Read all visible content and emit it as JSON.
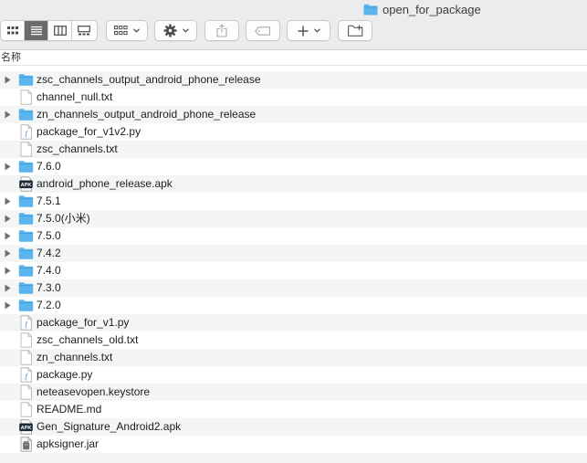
{
  "window": {
    "title": "open_for_package"
  },
  "toolbar": {
    "view_modes": [
      {
        "name": "icon-view",
        "active": false
      },
      {
        "name": "list-view",
        "active": true
      },
      {
        "name": "column-view",
        "active": false
      },
      {
        "name": "gallery-view",
        "active": false
      }
    ],
    "group_button_icon": "grid-group-icon",
    "action_button_icon": "gear-icon",
    "share_button_icon": "share-icon",
    "tag_button_icon": "tag-icon",
    "add_button_icon": "plus-icon",
    "new_folder_button_icon": "new-folder-icon"
  },
  "columns": {
    "name_header": "名称"
  },
  "files": [
    {
      "name": "zsc_channels_output_android_phone_release",
      "kind": "folder",
      "expandable": true
    },
    {
      "name": "channel_null.txt",
      "kind": "text",
      "expandable": false
    },
    {
      "name": "zn_channels_output_android_phone_release",
      "kind": "folder",
      "expandable": true
    },
    {
      "name": "package_for_v1v2.py",
      "kind": "python",
      "expandable": false
    },
    {
      "name": "zsc_channels.txt",
      "kind": "text",
      "expandable": false
    },
    {
      "name": "7.6.0",
      "kind": "folder",
      "expandable": true
    },
    {
      "name": "android_phone_release.apk",
      "kind": "apk",
      "expandable": false
    },
    {
      "name": "7.5.1",
      "kind": "folder",
      "expandable": true
    },
    {
      "name": "7.5.0(小米)",
      "kind": "folder",
      "expandable": true
    },
    {
      "name": "7.5.0",
      "kind": "folder",
      "expandable": true
    },
    {
      "name": "7.4.2",
      "kind": "folder",
      "expandable": true
    },
    {
      "name": "7.4.0",
      "kind": "folder",
      "expandable": true
    },
    {
      "name": "7.3.0",
      "kind": "folder",
      "expandable": true
    },
    {
      "name": "7.2.0",
      "kind": "folder",
      "expandable": true
    },
    {
      "name": "package_for_v1.py",
      "kind": "python",
      "expandable": false
    },
    {
      "name": "zsc_channels_old.txt",
      "kind": "text",
      "expandable": false
    },
    {
      "name": "zn_channels.txt",
      "kind": "text",
      "expandable": false
    },
    {
      "name": "package.py",
      "kind": "python",
      "expandable": false
    },
    {
      "name": "neteasevopen.keystore",
      "kind": "text",
      "expandable": false
    },
    {
      "name": "README.md",
      "kind": "text",
      "expandable": false
    },
    {
      "name": "Gen_Signature_Android2.apk",
      "kind": "apk",
      "expandable": false
    },
    {
      "name": "apksigner.jar",
      "kind": "jar",
      "expandable": false
    }
  ],
  "apk_badge_text": "APK",
  "colors": {
    "folder": "#5bb4ec",
    "folder_dark": "#3a9ddc",
    "active_segment": "#6a6a6a",
    "stripe": "#f4f5f5"
  }
}
